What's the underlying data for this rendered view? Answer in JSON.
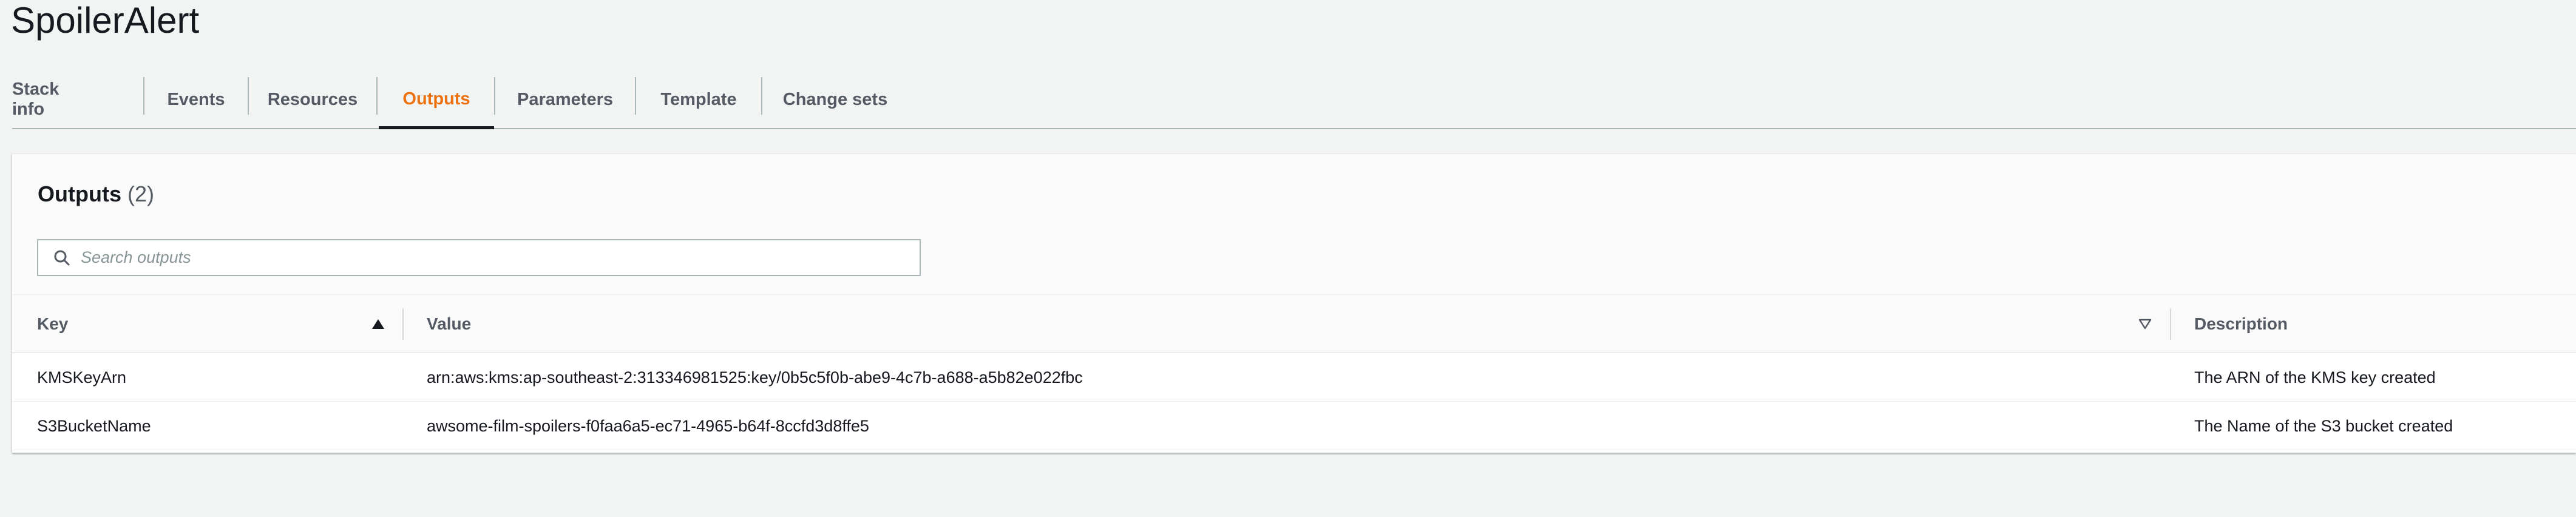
{
  "page": {
    "title": "SpoilerAlert"
  },
  "tabs": [
    {
      "label": "Stack info",
      "active": false
    },
    {
      "label": "Events",
      "active": false
    },
    {
      "label": "Resources",
      "active": false
    },
    {
      "label": "Outputs",
      "active": true
    },
    {
      "label": "Parameters",
      "active": false
    },
    {
      "label": "Template",
      "active": false
    },
    {
      "label": "Change sets",
      "active": false
    }
  ],
  "outputs": {
    "title": "Outputs",
    "count": "(2)",
    "search": {
      "placeholder": "Search outputs",
      "value": ""
    },
    "columns": {
      "key": "Key",
      "value": "Value",
      "description": "Description"
    },
    "sort": {
      "key": "ascending",
      "value": "unsorted"
    },
    "rows": [
      {
        "key": "KMSKeyArn",
        "value": "arn:aws:kms:ap-southeast-2:313346981525:key/0b5c5f0b-abe9-4c7b-a688-a5b82e022fbc",
        "description": "The ARN of the KMS key created"
      },
      {
        "key": "S3BucketName",
        "value": "awsome-film-spoilers-f0faa6a5-ec71-4965-b64f-8ccfd3d8ffe5",
        "description": "The Name of the S3 bucket created"
      }
    ]
  },
  "colors": {
    "background": "#f2f3f3",
    "active_tab": "#ec7211",
    "text": "#16191f",
    "muted_text": "#545b64",
    "border": "#aab7b8"
  },
  "icons": {
    "search": "search-icon",
    "sort_key": "caret-up-filled-icon",
    "sort_value": "caret-down-outline-icon"
  }
}
